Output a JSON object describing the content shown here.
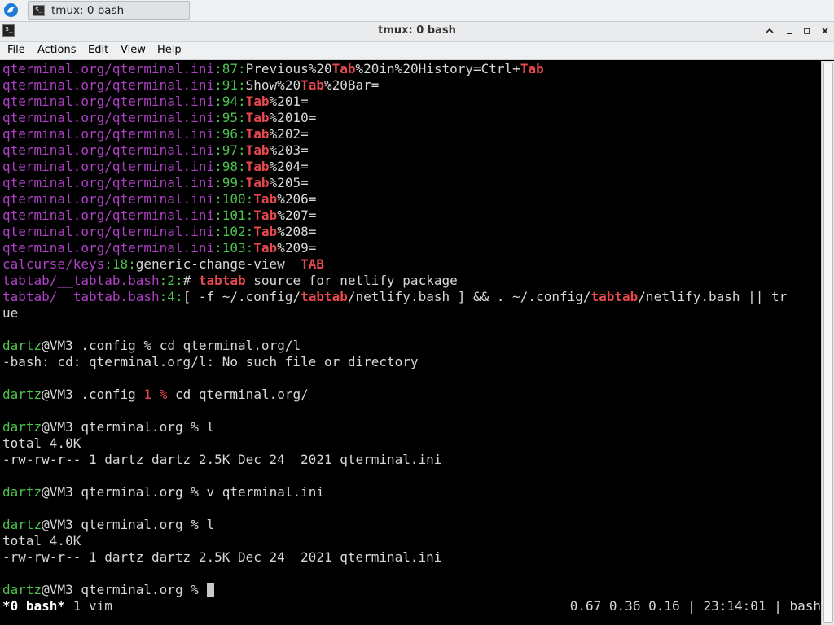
{
  "taskbar": {
    "task_title": "tmux: 0 bash"
  },
  "window": {
    "title": "tmux: 0 bash"
  },
  "menu": [
    "File",
    "Actions",
    "Edit",
    "View",
    "Help"
  ],
  "terminal": {
    "grep_results": [
      {
        "file": "qterminal.org/qterminal.ini",
        "line": "87",
        "pre": "Previous%20",
        "match": "Tab",
        "post": "%20in%20History=Ctrl+",
        "match2": "Tab",
        "post2": ""
      },
      {
        "file": "qterminal.org/qterminal.ini",
        "line": "91",
        "pre": "Show%20",
        "match": "Tab",
        "post": "%20Bar=",
        "match2": "",
        "post2": ""
      },
      {
        "file": "qterminal.org/qterminal.ini",
        "line": "94",
        "pre": "",
        "match": "Tab",
        "post": "%201=",
        "match2": "",
        "post2": ""
      },
      {
        "file": "qterminal.org/qterminal.ini",
        "line": "95",
        "pre": "",
        "match": "Tab",
        "post": "%2010=",
        "match2": "",
        "post2": ""
      },
      {
        "file": "qterminal.org/qterminal.ini",
        "line": "96",
        "pre": "",
        "match": "Tab",
        "post": "%202=",
        "match2": "",
        "post2": ""
      },
      {
        "file": "qterminal.org/qterminal.ini",
        "line": "97",
        "pre": "",
        "match": "Tab",
        "post": "%203=",
        "match2": "",
        "post2": ""
      },
      {
        "file": "qterminal.org/qterminal.ini",
        "line": "98",
        "pre": "",
        "match": "Tab",
        "post": "%204=",
        "match2": "",
        "post2": ""
      },
      {
        "file": "qterminal.org/qterminal.ini",
        "line": "99",
        "pre": "",
        "match": "Tab",
        "post": "%205=",
        "match2": "",
        "post2": ""
      },
      {
        "file": "qterminal.org/qterminal.ini",
        "line": "100",
        "pre": "",
        "match": "Tab",
        "post": "%206=",
        "match2": "",
        "post2": ""
      },
      {
        "file": "qterminal.org/qterminal.ini",
        "line": "101",
        "pre": "",
        "match": "Tab",
        "post": "%207=",
        "match2": "",
        "post2": ""
      },
      {
        "file": "qterminal.org/qterminal.ini",
        "line": "102",
        "pre": "",
        "match": "Tab",
        "post": "%208=",
        "match2": "",
        "post2": ""
      },
      {
        "file": "qterminal.org/qterminal.ini",
        "line": "103",
        "pre": "",
        "match": "Tab",
        "post": "%209=",
        "match2": "",
        "post2": ""
      },
      {
        "file": "calcurse/keys",
        "line": "18",
        "pre": "generic-change-view  ",
        "match": "TAB",
        "post": "",
        "match2": "",
        "post2": ""
      },
      {
        "file": "tabtab/__tabtab.bash",
        "line": "2",
        "pre": "# ",
        "match": "tabtab",
        "post": " source for netlify package",
        "match2": "",
        "post2": ""
      },
      {
        "file": "tabtab/__tabtab.bash",
        "line": "4",
        "pre": "[ -f ~/.config/",
        "match": "tabtab",
        "post": "/netlify.bash ] && . ~/.config/",
        "match2": "tabtab",
        "post2": "/netlify.bash || tr"
      }
    ],
    "wrap_line": "ue",
    "user": "dartz",
    "host_prefix": "@VM3 ",
    "sessions": [
      {
        "dir": ".config",
        "status": "",
        "prompt_char": "%",
        "command": "cd qterminal.org/l"
      },
      {
        "dir": ".config",
        "status": "1",
        "prompt_char": "%",
        "command": "cd qterminal.org/"
      },
      {
        "dir": "qterminal.org",
        "status": "",
        "prompt_char": "%",
        "command": "l"
      },
      {
        "dir": "qterminal.org",
        "status": "",
        "prompt_char": "%",
        "command": "v qterminal.ini"
      },
      {
        "dir": "qterminal.org",
        "status": "",
        "prompt_char": "%",
        "command": "l"
      },
      {
        "dir": "qterminal.org",
        "status": "",
        "prompt_char": "%",
        "command": ""
      }
    ],
    "error_line": "-bash: cd: qterminal.org/l: No such file or directory",
    "total_line": "total 4.0K",
    "ls_line": "-rw-rw-r-- 1 dartz dartz 2.5K Dec 24  2021 qterminal.ini"
  },
  "tmux_status": {
    "current_window": "*0 bash*",
    "other_window": "1 vim",
    "right": "0.67 0.36 0.16 | 23:14:01 | bash"
  }
}
